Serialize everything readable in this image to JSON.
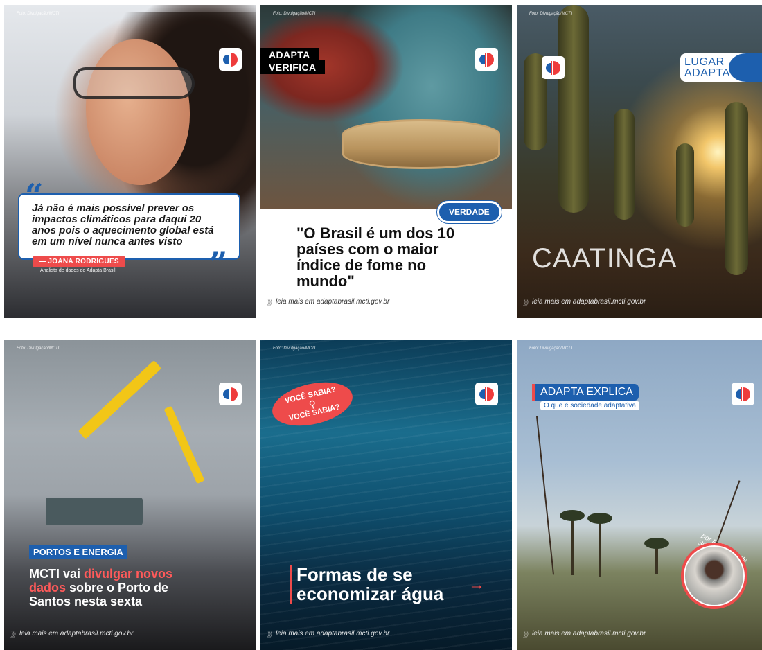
{
  "cards": {
    "testimonial": {
      "photo_credit": "Foto: Divulgação/MCTI",
      "quote": "Já não é mais possível prever os impactos climáticos para daqui 20 anos pois o aquecimento global  está em um nível nunca antes visto",
      "author": "— JOANA RODRIGUES",
      "role": "Analista de dados do Adapta Brasil"
    },
    "fact_check": {
      "photo_credit": "Foto: Divulgação/MCTI",
      "tag_line1": "ADAPTA",
      "tag_line2": "VERIFICA",
      "verdict": "VERDADE",
      "claim": "\"O Brasil é um dos 10 países com o maior índice de fome no mundo\"",
      "footer": "leia mais em adaptabrasil.mcti.gov.br"
    },
    "place": {
      "photo_credit": "Foto: Divulgação/MCTI",
      "series_line1": "LUGAR",
      "series_line2": "ADAPTA",
      "title": "CAATINGA",
      "footer": "leia mais em adaptabrasil.mcti.gov.br"
    },
    "news": {
      "photo_credit": "Foto: Divulgação/MCTI",
      "category": "PORTOS E ENERGIA",
      "headline_part1": "MCTI vai ",
      "headline_highlight": "divulgar novos dados",
      "headline_part2": " sobre o Porto de Santos nesta sexta",
      "footer": "leia mais em adaptabrasil.mcti.gov.br"
    },
    "did_you_know": {
      "photo_credit": "Foto: Divulgação/MCTI",
      "bubble_line1": "VOCÊ SABIA?",
      "bubble_line2": "VOCÊ SABIA?",
      "headline": "Formas de se economizar água",
      "arrow": "→",
      "footer": "leia mais em adaptabrasil.mcti.gov.br"
    },
    "explainer": {
      "photo_credit": "Foto: Divulgação/MCTI",
      "title": "ADAPTA EXPLICA",
      "subtitle": "O que é sociedade adaptativa",
      "author": "por Fulaninha de Silva",
      "footer": "leia mais em adaptabrasil.mcti.gov.br"
    }
  },
  "colors": {
    "brand_blue": "#1d5fae",
    "brand_red": "#ee4b4b"
  },
  "icons": {
    "logo": "adapta-brasil-logo-icon",
    "wave": "sound-wave-icon",
    "search": "magnifier-icon"
  }
}
